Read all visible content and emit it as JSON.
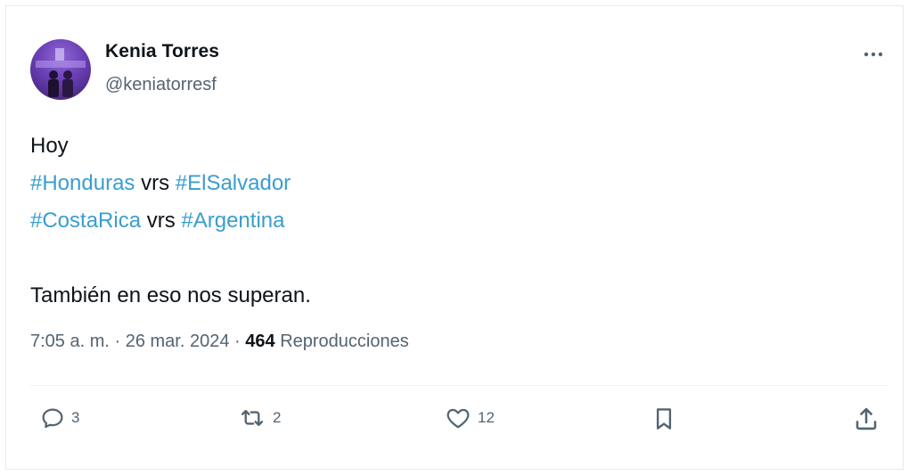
{
  "author": {
    "name": "Kenia Torres",
    "handle": "@keniatorresf"
  },
  "tweet": {
    "lines": [
      [
        {
          "text": "Hoy",
          "tag": false
        }
      ],
      [
        {
          "text": "#Honduras",
          "tag": true
        },
        {
          "text": " vrs ",
          "tag": false
        },
        {
          "text": "#ElSalvador",
          "tag": true
        }
      ],
      [
        {
          "text": "#CostaRica",
          "tag": true
        },
        {
          "text": " vrs ",
          "tag": false
        },
        {
          "text": "#Argentina",
          "tag": true
        }
      ],
      [],
      [
        {
          "text": "También en eso nos superan.",
          "tag": false
        }
      ]
    ]
  },
  "meta": {
    "time": "7:05 a. m.",
    "date": "26 mar. 2024",
    "views_count": "464",
    "views_label": "Reproducciones"
  },
  "actions": {
    "replies": "3",
    "reposts": "2",
    "likes": "12"
  },
  "colors": {
    "hashtag": "#3a9dd0",
    "secondary_text": "#536471",
    "primary_text": "#0f1419",
    "divider": "#eff3f4"
  },
  "icons": {
    "more": "more-horizontal-icon",
    "reply": "reply-bubble-icon",
    "repost": "repost-icon",
    "like": "heart-icon",
    "bookmark": "bookmark-icon",
    "share": "share-upload-icon"
  }
}
